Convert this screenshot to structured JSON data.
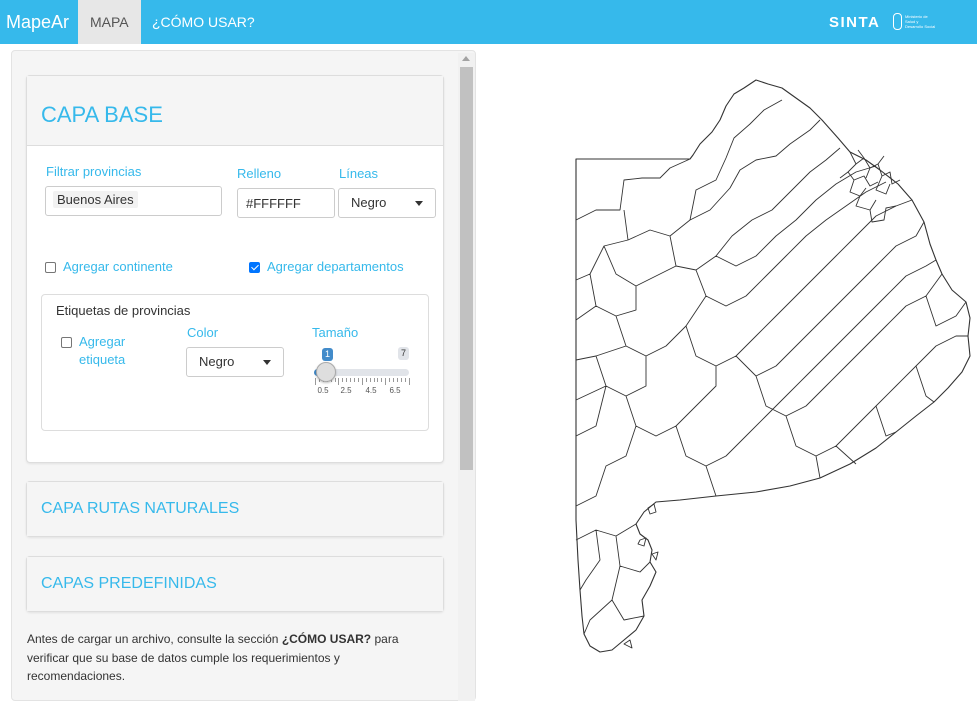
{
  "navbar": {
    "brand": "MapeAr",
    "tabs": [
      {
        "label": "MAPA",
        "active": true
      },
      {
        "label": "¿CÓMO USAR?",
        "active": false
      }
    ],
    "logo_text": "SINTA",
    "ministerio_text": "Ministerio de Salud y Desarrollo Social · Argentina",
    "accent_color": "#36b9eb"
  },
  "capa_base": {
    "title": "CAPA BASE",
    "filtrar_label": "Filtrar provincias",
    "filtrar_value": "Buenos Aires",
    "relleno_label": "Relleno",
    "relleno_value": "#FFFFFF",
    "lineas_label": "Líneas",
    "lineas_value": "Negro",
    "agregar_continente_label": "Agregar continente",
    "agregar_continente_checked": false,
    "agregar_departamentos_label": "Agregar departamentos",
    "agregar_departamentos_checked": true,
    "etiquetas": {
      "title": "Etiquetas de provincias",
      "agregar_etiqueta_label_1": "Agregar",
      "agregar_etiqueta_label_2": "etiqueta",
      "agregar_etiqueta_checked": false,
      "color_label": "Color",
      "color_value": "Negro",
      "tamano_label": "Tamaño",
      "slider": {
        "min": "1",
        "max": "7",
        "value": 1,
        "grid": [
          "0.5",
          "2.5",
          "4.5",
          "6.5"
        ]
      }
    }
  },
  "capa_rutas": {
    "title": "CAPA RUTAS NATURALES"
  },
  "capas_predefinidas": {
    "title": "CAPAS PREDEFINIDAS"
  },
  "info": {
    "text_before": "Antes de cargar un archivo, consulte la sección ",
    "text_bold": "¿CÓMO USAR?",
    "text_after": " para verificar que su base de datos cumple los requerimientos y recomendaciones."
  },
  "map": {
    "region": "Buenos Aires",
    "fill_color": "#FFFFFF",
    "line_color": "#333333"
  }
}
